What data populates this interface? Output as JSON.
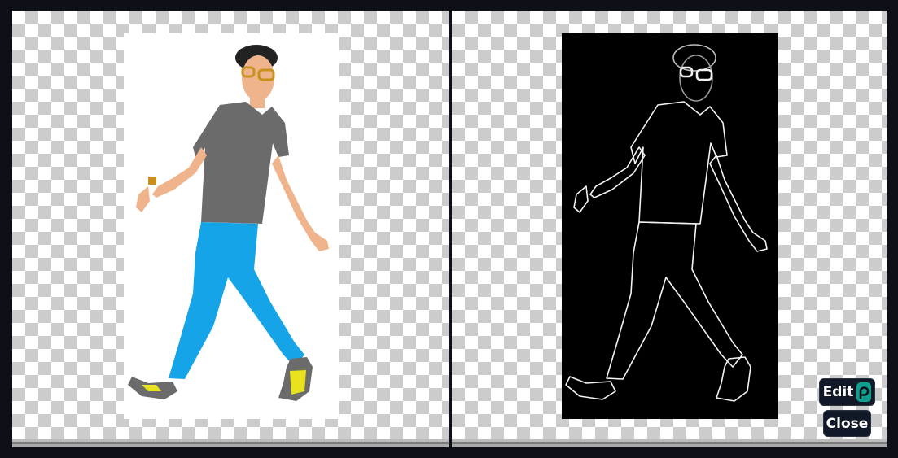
{
  "toolbar": {
    "edit_label": "Edit",
    "close_label": "Close"
  },
  "icons": {
    "edit": "photopea-logo-icon"
  },
  "colors": {
    "background": "#0d1117",
    "button_bg": "#111827",
    "edit_icon_bg": "#0f9f8f",
    "checker_light": "#ffffff",
    "checker_dark": "#cccccc"
  }
}
